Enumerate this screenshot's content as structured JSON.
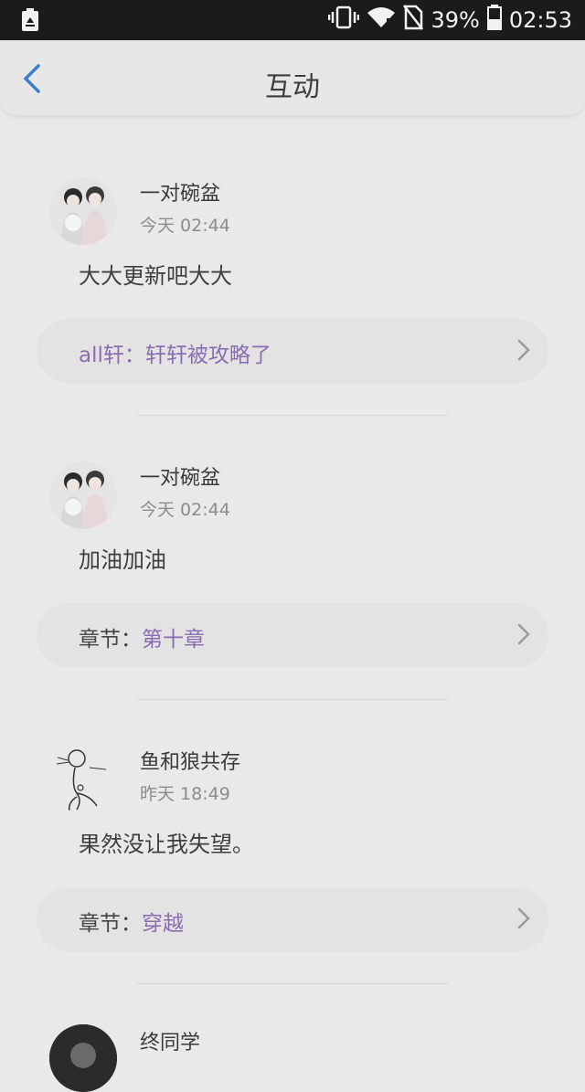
{
  "status_bar": {
    "battery_percent": "39%",
    "time": "02:53"
  },
  "header": {
    "title": "互动"
  },
  "items": [
    {
      "username": "一对碗盆",
      "time": "今天 02:44",
      "comment": "大大更新吧大大",
      "ref_prefix": "",
      "ref_link": "all轩：轩轩被攻略了"
    },
    {
      "username": "一对碗盆",
      "time": "今天 02:44",
      "comment": "加油加油",
      "ref_prefix": "章节：",
      "ref_link": "第十章"
    },
    {
      "username": "鱼和狼共存",
      "time": "昨天 18:49",
      "comment": "果然没让我失望。",
      "ref_prefix": "章节：",
      "ref_link": "穿越"
    },
    {
      "username": "终同学"
    }
  ]
}
